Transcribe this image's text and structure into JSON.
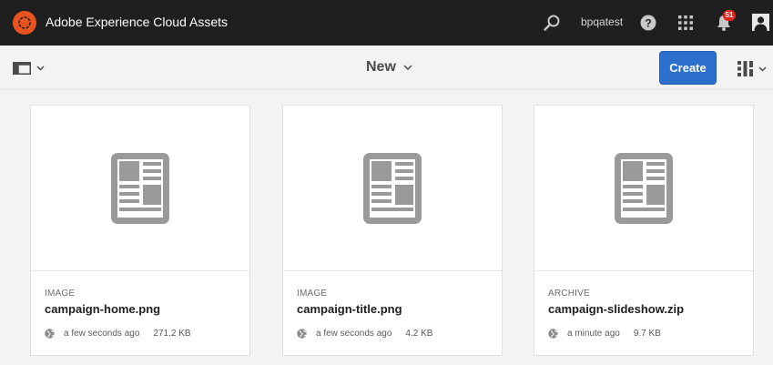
{
  "header": {
    "app_title": "Adobe Experience Cloud Assets",
    "username": "bpqatest",
    "notification_count": "51",
    "accent_color": "#e8541f"
  },
  "actionbar": {
    "create_menu_label": "New",
    "create_button_label": "Create",
    "button_color": "#2d6fcd"
  },
  "cards": [
    {
      "type": "IMAGE",
      "name": "campaign-home.png",
      "modified": "a few seconds ago",
      "size": "271.2 KB"
    },
    {
      "type": "IMAGE",
      "name": "campaign-title.png",
      "modified": "a few seconds ago",
      "size": "4.2 KB"
    },
    {
      "type": "ARCHIVE",
      "name": "campaign-slideshow.zip",
      "modified": "a minute ago",
      "size": "9.7 KB"
    }
  ]
}
